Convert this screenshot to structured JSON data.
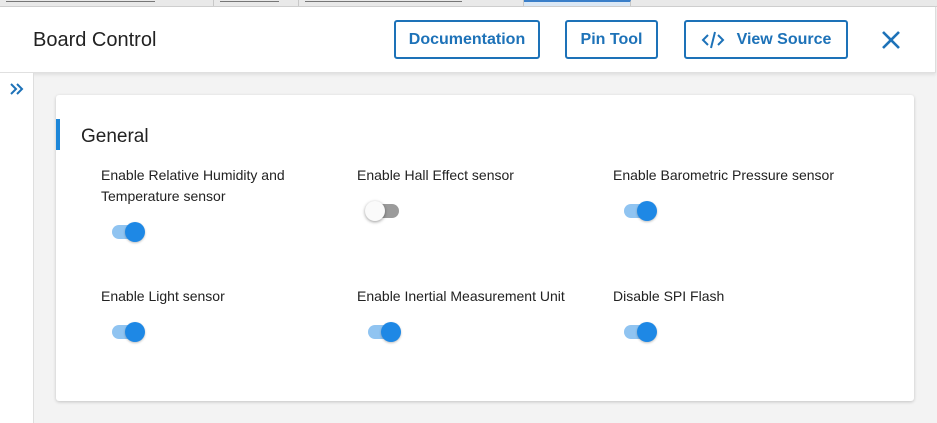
{
  "header": {
    "title": "Board Control",
    "documentation_label": "Documentation",
    "pin_tool_label": "Pin Tool",
    "view_source_label": "View Source"
  },
  "icons": {
    "close": "close-icon",
    "code": "code-icon",
    "expand": "double-chevron-right-icon"
  },
  "section": {
    "title": "General",
    "options": [
      {
        "label": "Enable Relative Humidity and Temperature sensor",
        "enabled": true
      },
      {
        "label": "Enable Hall Effect sensor",
        "enabled": false
      },
      {
        "label": "Enable Barometric Pressure sensor",
        "enabled": true
      },
      {
        "label": "Enable Light sensor",
        "enabled": true
      },
      {
        "label": "Enable Inertial Measurement Unit",
        "enabled": true
      },
      {
        "label": "Disable SPI Flash",
        "enabled": true
      }
    ]
  },
  "colors": {
    "accent": "#1d72b8",
    "toggle_on": "#1e88e5",
    "toggle_on_track": "#90c4f1",
    "toggle_off_track": "#9b9b9b"
  }
}
